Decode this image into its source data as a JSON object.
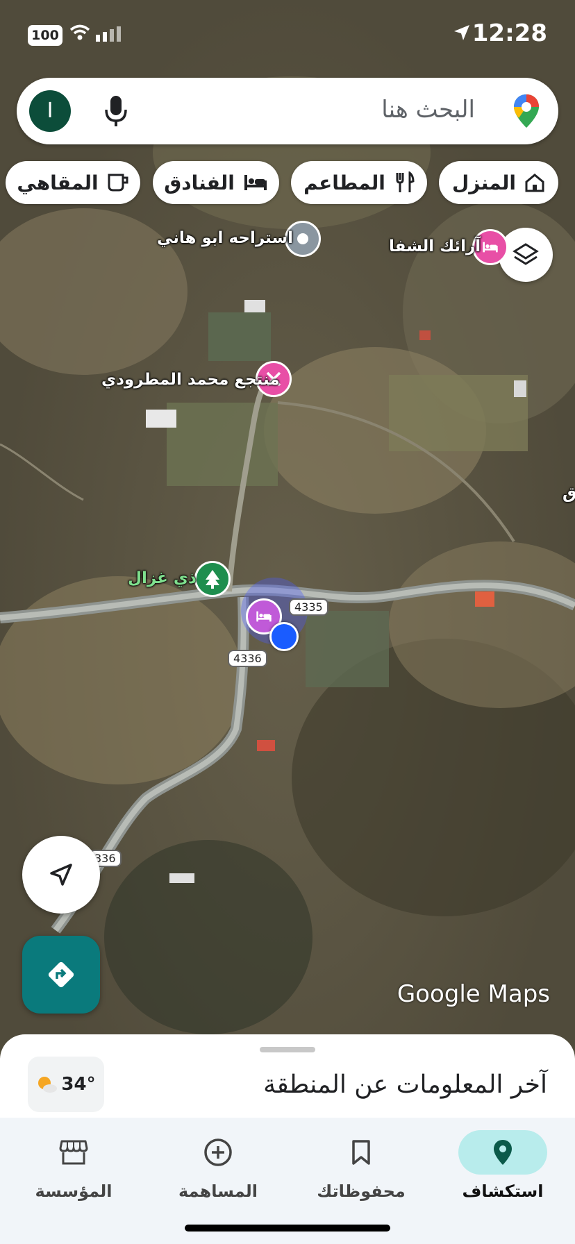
{
  "status": {
    "time": "12:28",
    "battery": "100"
  },
  "search": {
    "placeholder": "البحث هنا",
    "avatar_letter": "I"
  },
  "chips": [
    {
      "label": "المنزل",
      "icon": "home-icon"
    },
    {
      "label": "المطاعم",
      "icon": "restaurant-icon"
    },
    {
      "label": "الفنادق",
      "icon": "hotel-icon"
    },
    {
      "label": "المقاهي",
      "icon": "cafe-icon"
    }
  ],
  "map": {
    "places": [
      {
        "name": "استراحه ابو هاني",
        "type": "generic-place"
      },
      {
        "name": "آرائك الشفا",
        "type": "hotel"
      },
      {
        "name": "منتجع محمد المطرودي",
        "type": "resort"
      },
      {
        "name": "ذي غزال",
        "type": "park"
      }
    ],
    "road_shields": [
      "4335",
      "4336",
      "336"
    ],
    "edge_label": "ق",
    "attribution": "Google Maps"
  },
  "sheet": {
    "title": "آخر المعلومات عن المنطقة",
    "temperature": "34°"
  },
  "nav": [
    {
      "label": "استكشاف",
      "icon": "explore-pin-icon",
      "active": true
    },
    {
      "label": "محفوظاتك",
      "icon": "bookmark-icon",
      "active": false
    },
    {
      "label": "المساهمة",
      "icon": "add-circle-icon",
      "active": false
    },
    {
      "label": "المؤسسة",
      "icon": "store-icon",
      "active": false
    }
  ],
  "colors": {
    "accent": "#0a7a7c",
    "nav_active_bg": "#b8ecec",
    "pink_pin": "#e84fa6",
    "location_dot": "#1a5cff"
  }
}
